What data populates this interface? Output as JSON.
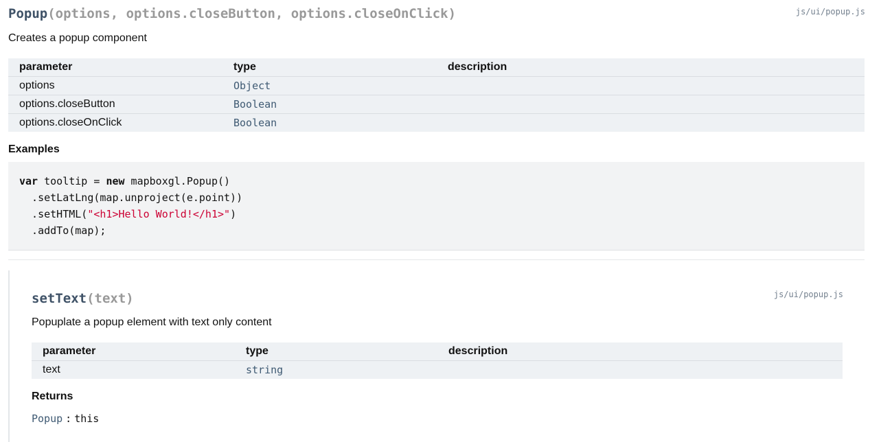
{
  "popup": {
    "name": "Popup",
    "params_sig": "(options, options.closeButton, options.closeOnClick)",
    "source": "js/ui/popup.js",
    "description": "Creates a popup component",
    "table_headers": [
      "parameter",
      "type",
      "description"
    ],
    "params": [
      {
        "name": "options",
        "type": "Object",
        "description": ""
      },
      {
        "name": "options.closeButton",
        "type": "Boolean",
        "description": ""
      },
      {
        "name": "options.closeOnClick",
        "type": "Boolean",
        "description": ""
      }
    ],
    "examples_heading": "Examples",
    "code": {
      "line1_kw1": "var",
      "line1_a": " tooltip = ",
      "line1_kw2": "new",
      "line1_b": " mapboxgl.Popup()",
      "line2": "  .setLatLng(map.unproject(e.point))",
      "line3_a": "  .setHTML(",
      "line3_str": "\"<h1>Hello World!</h1>\"",
      "line3_b": ")",
      "line4": "  .addTo(map);"
    }
  },
  "settext": {
    "name": "setText",
    "params_sig": "(text)",
    "source": "js/ui/popup.js",
    "description": "Popuplate a popup element with text only content",
    "table_headers": [
      "parameter",
      "type",
      "description"
    ],
    "params": [
      {
        "name": "text",
        "type": "string",
        "description": ""
      }
    ],
    "returns_heading": "Returns",
    "returns_type": "Popup",
    "returns_sep": ":",
    "returns_desc": "this"
  }
}
